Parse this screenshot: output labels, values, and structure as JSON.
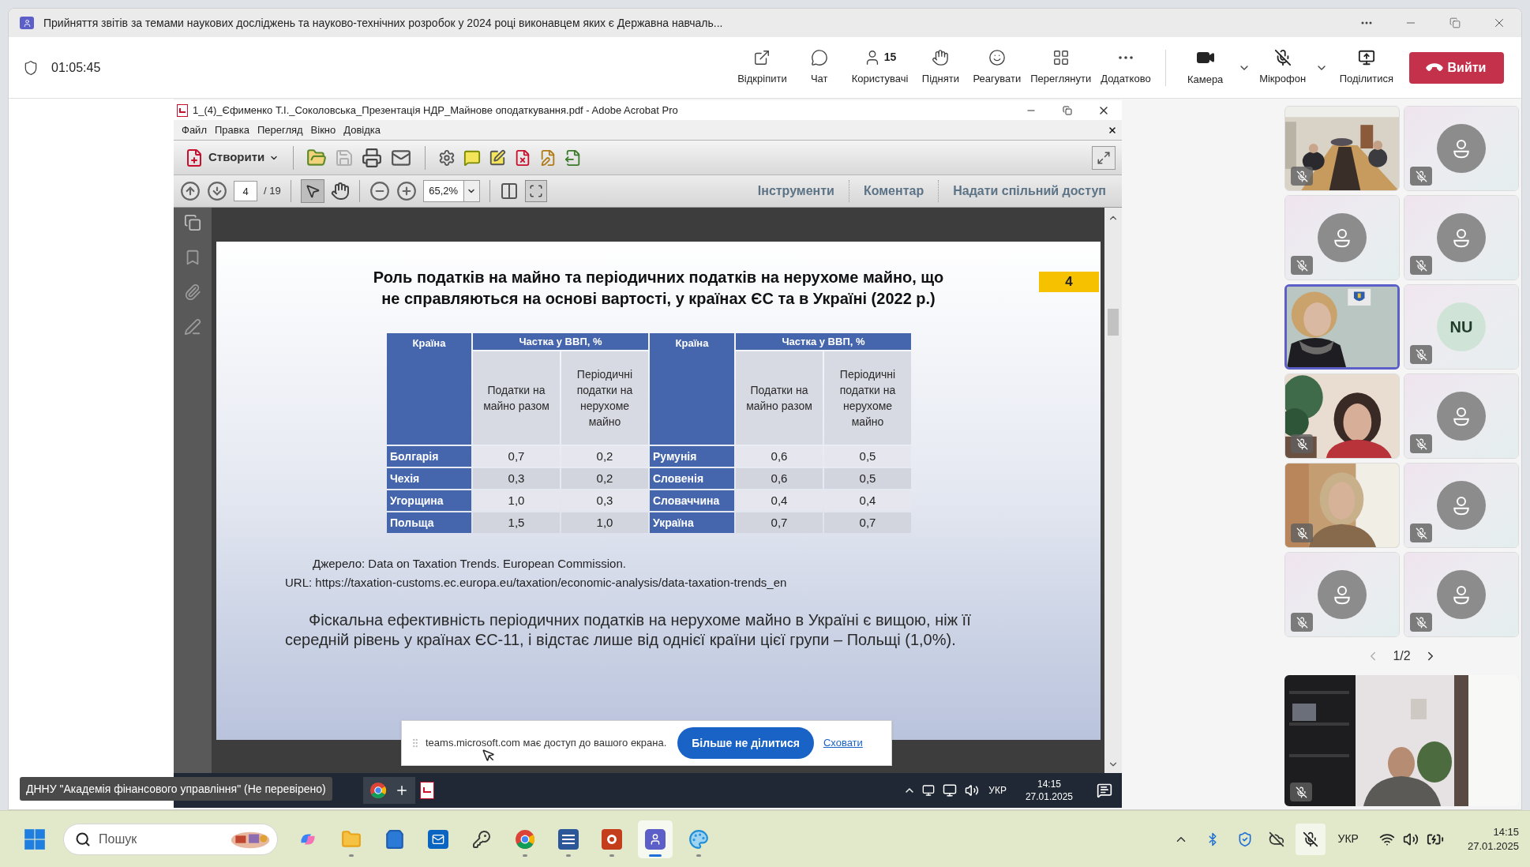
{
  "window": {
    "title": "Прийняття звітів за темами наукових досліджень та науково-технічних розробок у 2024 році виконавцем яких є Державна навчаль..."
  },
  "meeting_toolbar": {
    "timer": "01:05:45",
    "actions": [
      {
        "kind": "popout",
        "label": "Відкріпити"
      },
      {
        "kind": "chat",
        "label": "Чат"
      },
      {
        "kind": "people",
        "label": "Користувачі",
        "count": "15"
      },
      {
        "kind": "raise",
        "label": "Підняти"
      },
      {
        "kind": "react",
        "label": "Реагувати"
      },
      {
        "kind": "view",
        "label": "Переглянути"
      },
      {
        "kind": "more",
        "label": "Додатково"
      }
    ],
    "devices": [
      {
        "kind": "camera",
        "label": "Камера",
        "on": true
      },
      {
        "kind": "mic",
        "label": "Мікрофон",
        "on": false
      }
    ],
    "share": {
      "label": "Поділитися"
    },
    "leave": {
      "label": "Вийти"
    }
  },
  "shared_screen": {
    "acrobat": {
      "title": "1_(4)_Єфименко Т.І._Соколовська_Презентація НДР_Майнове оподаткування.pdf - Adobe Acrobat Pro",
      "menu": [
        "Файл",
        "Правка",
        "Перегляд",
        "Вікно",
        "Довідка"
      ],
      "create_button": "Створити",
      "page": "4",
      "page_total": "/ 19",
      "zoom": "65,2%",
      "panel_links": [
        "Інструменти",
        "Коментар",
        "Надати спільний доступ"
      ]
    },
    "slide": {
      "title": "Роль податків на майно та періодичних податків на нерухоме майно, що не справляються на основі вартості, у країнах ЄС та в Україні (2022 р.)",
      "page_badge": "4",
      "table": {
        "halves": [
          {
            "country_header": "Країна",
            "share_header": "Частка у ВВП, %",
            "subheaders": [
              "Податки на майно разом",
              "Періодичні податки на нерухоме майно"
            ],
            "rows": [
              {
                "country": "Болгарія",
                "values": [
                  "0,7",
                  "0,2"
                ]
              },
              {
                "country": "Чехія",
                "values": [
                  "0,3",
                  "0,2"
                ]
              },
              {
                "country": "Угорщина",
                "values": [
                  "1,0",
                  "0,3"
                ]
              },
              {
                "country": "Польща",
                "values": [
                  "1,5",
                  "1,0"
                ]
              }
            ]
          },
          {
            "country_header": "Країна",
            "share_header": "Частка у ВВП, %",
            "subheaders": [
              "Податки на майно разом",
              "Періодичні податки на нерухоме майно"
            ],
            "rows": [
              {
                "country": "Румунія",
                "values": [
                  "0,6",
                  "0,5"
                ]
              },
              {
                "country": "Словенія",
                "values": [
                  "0,6",
                  "0,5"
                ]
              },
              {
                "country": "Словаччина",
                "values": [
                  "0,4",
                  "0,4"
                ]
              },
              {
                "country": "Україна",
                "values": [
                  "0,7",
                  "0,7"
                ]
              }
            ]
          }
        ]
      },
      "source": "Джерело: Data on Taxation Trends. European Commission.",
      "url": "URL: https://taxation-customs.ec.europa.eu/taxation/economic-analysis/data-taxation-trends_en",
      "note": "Фіскальна ефективність періодичних податків на нерухоме майно в Україні є вищою, ніж її середній рівень у країнах ЄС-11, і відстає лише від однієї країни цієї групи – Польщі (1,0%)."
    },
    "share_notice": {
      "text": "teams.microsoft.com має доступ до вашого екрана.",
      "stop_button": "Більше не ділитися",
      "hide_link": "Сховати"
    },
    "remote_taskbar": {
      "tooltip": "ДННУ \"Академія фінансового управління\" (Не перевірено)",
      "language": "УКР",
      "time": "14:15",
      "date": "27.01.2025"
    }
  },
  "participants": {
    "tiles": [
      {
        "kind": "video",
        "muted": true,
        "speaking": false
      },
      {
        "kind": "avatar",
        "muted": true,
        "speaking": false
      },
      {
        "kind": "avatar",
        "muted": true,
        "speaking": false
      },
      {
        "kind": "avatar",
        "muted": true,
        "speaking": false
      },
      {
        "kind": "video",
        "muted": false,
        "speaking": true
      },
      {
        "kind": "initials",
        "initials": "NU",
        "muted": true,
        "speaking": false
      },
      {
        "kind": "video",
        "muted": true,
        "speaking": false
      },
      {
        "kind": "avatar",
        "muted": true,
        "speaking": false
      },
      {
        "kind": "video",
        "muted": true,
        "speaking": false
      },
      {
        "kind": "avatar",
        "muted": true,
        "speaking": false
      },
      {
        "kind": "avatar",
        "muted": true,
        "speaking": false
      },
      {
        "kind": "avatar",
        "muted": true,
        "speaking": false
      }
    ],
    "pager": "1/2",
    "self_view": {
      "muted": true
    }
  },
  "taskbar": {
    "search_placeholder": "Пошук",
    "apps": [
      {
        "kind": "copilot",
        "running": false,
        "selected": false
      },
      {
        "kind": "explorer",
        "running": true,
        "selected": false
      },
      {
        "kind": "store",
        "running": false,
        "selected": false
      },
      {
        "kind": "outlook",
        "running": false,
        "selected": false
      },
      {
        "kind": "keys",
        "running": false,
        "selected": false
      },
      {
        "kind": "chrome",
        "running": true,
        "selected": false
      },
      {
        "kind": "word",
        "running": true,
        "selected": false
      },
      {
        "kind": "powerpoint",
        "running": true,
        "selected": false
      },
      {
        "kind": "teams",
        "running": true,
        "selected": true
      },
      {
        "kind": "paint",
        "running": true,
        "selected": false
      }
    ],
    "language": "УКР",
    "time": "14:15",
    "date": "27.01.2025"
  }
}
